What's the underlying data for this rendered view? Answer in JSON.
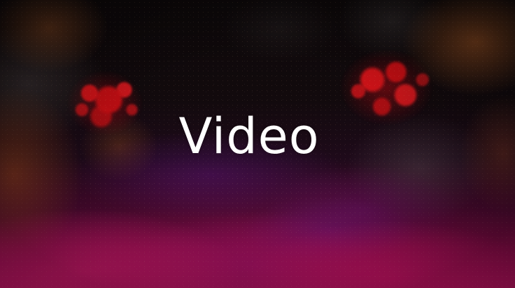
{
  "title": {
    "text": "Video",
    "color": "#ffffff"
  },
  "background": {
    "colors": {
      "base_dark": "#0b0709",
      "magenta": "#b3125e",
      "splash_red": "#d71419",
      "smoke_orange": "#b4501e"
    }
  }
}
